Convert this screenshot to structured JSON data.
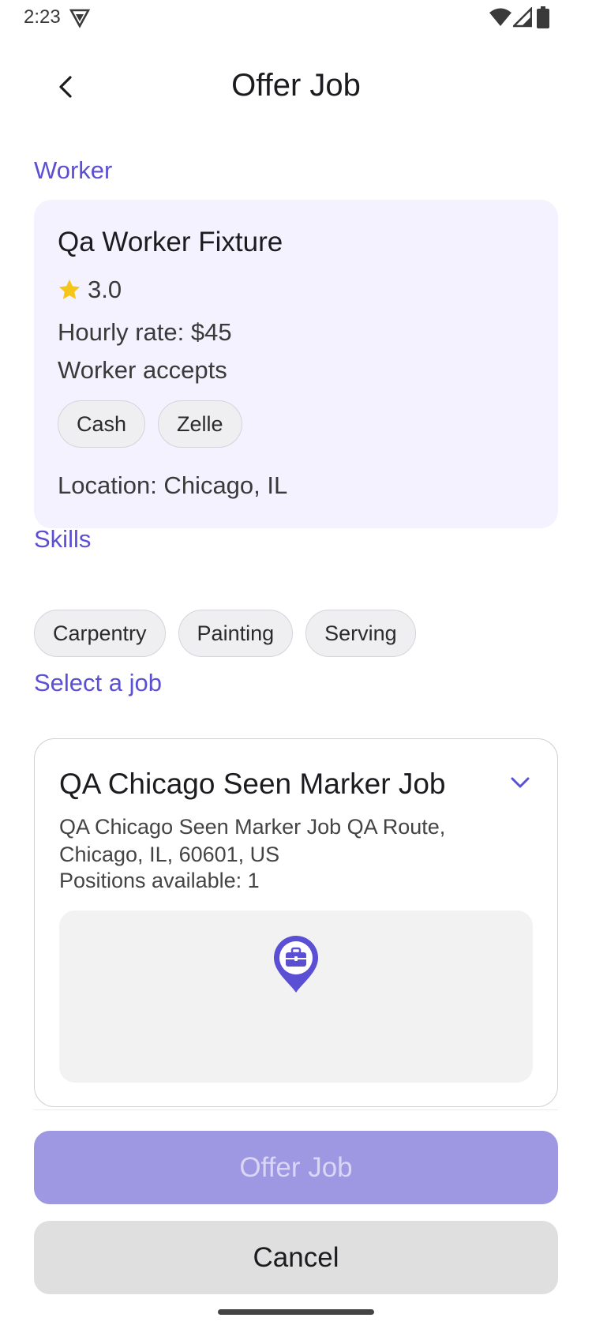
{
  "status_bar": {
    "time": "2:23",
    "icons": [
      "vpn-icon",
      "wifi-icon",
      "cell-signal-icon",
      "battery-icon"
    ]
  },
  "header": {
    "title": "Offer Job",
    "back_icon": "chevron-left-icon"
  },
  "worker_section": {
    "heading": "Worker",
    "name": "Qa Worker Fixture",
    "rating": "3.0",
    "hourly_rate": "Hourly rate: $45",
    "accepts_label": "Worker accepts",
    "payment_methods": [
      "Cash",
      "Zelle"
    ],
    "location": "Location: Chicago, IL"
  },
  "skills_section": {
    "heading": "Skills",
    "skills": [
      "Carpentry",
      "Painting",
      "Serving"
    ]
  },
  "job_section": {
    "heading": "Select a job",
    "selected_job": {
      "title": "QA Chicago Seen Marker Job",
      "address": "QA Chicago Seen Marker Job QA Route, Chicago, IL, 60601, US",
      "positions": "Positions available: 1"
    }
  },
  "actions": {
    "offer_label": "Offer Job",
    "cancel_label": "Cancel"
  },
  "colors": {
    "accent": "#5b4fd4",
    "card_bg": "#f4f2ff",
    "disabled_button": "#9e97e2",
    "star": "#f5c518"
  }
}
